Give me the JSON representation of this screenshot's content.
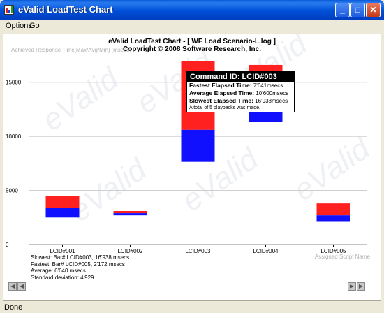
{
  "window": {
    "title": "eValid LoadTest Chart"
  },
  "menu": [
    "Options",
    "Go"
  ],
  "chart_header": {
    "line1": "eValid LoadTest Chart - [ WF Load Scenario-L.log ]",
    "line2": "Copyright © 2008 Software Research, Inc."
  },
  "axis": {
    "y_title": "Achieved Response Time[Max/Avg/Min] (msecs)",
    "x_title": "Assigned Script Name"
  },
  "chart_data": {
    "type": "bar",
    "categories": [
      "LCID#001",
      "LCID#002",
      "LCID#003",
      "LCID#004",
      "LCID#005"
    ],
    "series": [
      {
        "name": "Max",
        "values": [
          4500,
          3100,
          16938,
          16600,
          3800
        ]
      },
      {
        "name": "Avg",
        "values": [
          3400,
          2900,
          10600,
          12700,
          2700
        ]
      },
      {
        "name": "Min",
        "values": [
          2500,
          2700,
          7641,
          11300,
          2100
        ]
      }
    ],
    "ylim": [
      0,
      17500
    ],
    "yticks": [
      0,
      5000,
      10000,
      15000
    ],
    "colors": {
      "upper": "#FF2020",
      "lower": "#1010FF"
    },
    "grid": true
  },
  "stats": {
    "slowest": "Slowest: Bar# LCID#003, 16'938 msecs",
    "fastest": "Fastest: Bar# LCID#005, 2'172 msecs",
    "average": "Average: 6'640 msecs",
    "stddev": "Standard deviation: 4'929"
  },
  "tooltip": {
    "title": "Command ID: LCID#003",
    "fastest_label": "Fastest Elapsed Time:",
    "fastest_value": "7'641msecs",
    "average_label": "Average Elapsed Time:",
    "average_value": "10'600msecs",
    "slowest_label": "Slowest Elapsed Time:",
    "slowest_value": "16'938msecs",
    "note": "A total of 5 playbacks was made."
  },
  "watermark": "eValid",
  "status": "Done"
}
